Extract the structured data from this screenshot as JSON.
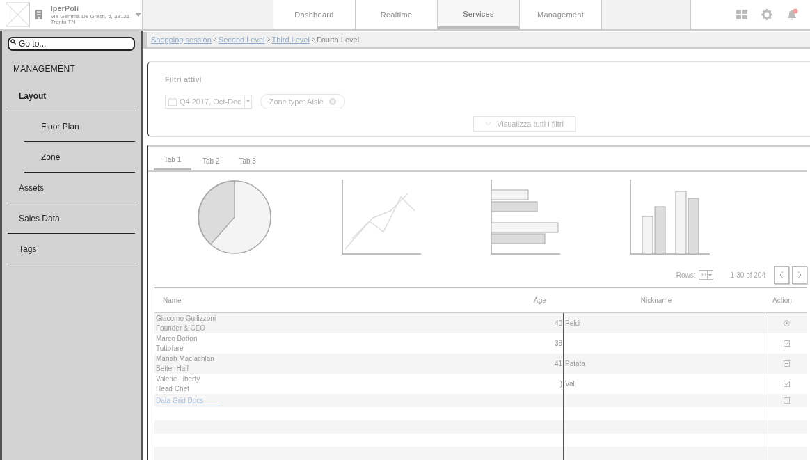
{
  "brand": {
    "name": "IperPoli",
    "address_line_1": "Via Gemma De Gresti, 5, 38121",
    "address_line_2": "Trento TN"
  },
  "nav_tabs": [
    {
      "label": "Dashboard",
      "selected": false
    },
    {
      "label": "Realtime",
      "selected": false
    },
    {
      "label": "Services",
      "selected": true
    },
    {
      "label": "Management",
      "selected": false
    }
  ],
  "notifications": {
    "unread": true
  },
  "sidebar": {
    "search": {
      "placeholder": "Go to..."
    },
    "heading": "MANAGEMENT",
    "items": [
      {
        "label": "Layout",
        "selected": true,
        "children": [
          {
            "label": "Floor Plan",
            "selected": false
          },
          {
            "label": "Zone",
            "selected": false
          }
        ]
      },
      {
        "label": "Assets",
        "selected": false
      },
      {
        "label": "Sales Data",
        "selected": false
      },
      {
        "label": "Tags",
        "selected": false
      }
    ]
  },
  "breadcrumb": [
    {
      "label": "Shopping session",
      "link": true
    },
    {
      "label": "Second Level",
      "link": true
    },
    {
      "label": "Third Level",
      "link": true
    },
    {
      "label": "Fourth Level",
      "link": false
    }
  ],
  "filters": {
    "title": "Filtri attivi",
    "date": "Q4 2017, Oct-Dec",
    "chips": [
      "Zone type: Aisle"
    ],
    "show_all": "Visualizza tutti i filtri"
  },
  "tabs": [
    {
      "label": "Tab 1",
      "selected": true
    },
    {
      "label": "Tab 2",
      "selected": false
    },
    {
      "label": "Tab 3",
      "selected": false
    }
  ],
  "pagination": {
    "rows_label": "Rows:",
    "rows_value": "30",
    "range": "1-30 of 204"
  },
  "table": {
    "columns": [
      "Name",
      "Age",
      "Nickname",
      "Action"
    ],
    "rows": [
      {
        "kind": "person",
        "name": "Giacomo Guilizzoni",
        "role": "Founder & CEO",
        "age": "40",
        "nickname": "Peldi",
        "action": {
          "kind": "radio",
          "checked": true
        }
      },
      {
        "kind": "person",
        "name": "Marco Botton",
        "role": "Tuttofare",
        "age": "38",
        "action": {
          "kind": "checkbox",
          "checked": true
        }
      },
      {
        "kind": "person",
        "name": "Mariah Maclachlan",
        "role": "Better Half",
        "age": "41",
        "nickname": "Patata",
        "action": {
          "kind": "minus"
        }
      },
      {
        "kind": "person",
        "name": "Valerie Liberty",
        "role": "Head Chef",
        "age": ":)",
        "nickname": "Val",
        "action": {
          "kind": "checkbox",
          "checked": true
        }
      },
      {
        "kind": "link",
        "name": "Data Grid Docs",
        "action": {
          "kind": "checkbox",
          "checked": false
        }
      }
    ]
  }
}
